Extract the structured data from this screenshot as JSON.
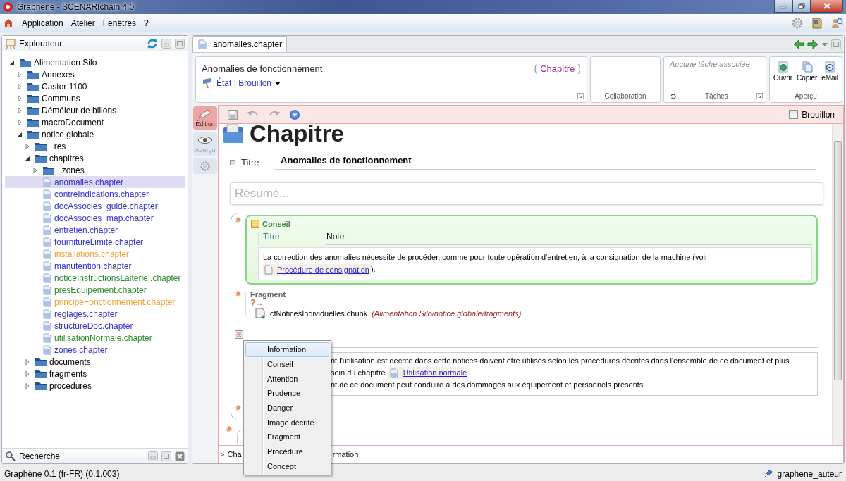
{
  "window": {
    "title": "Graphene - SCENARIchain 4.0"
  },
  "menu": [
    "Application",
    "Atelier",
    "Fenêtres",
    "?"
  ],
  "explorer": {
    "title": "Explorateur",
    "tree": [
      {
        "label": "Alimentation Silo",
        "kind": "folder",
        "expanded": true,
        "selected": false,
        "children": [
          {
            "label": "Annexes",
            "kind": "folder",
            "expanded": false,
            "selected": false
          },
          {
            "label": "Castor 1100",
            "kind": "folder",
            "expanded": false,
            "selected": false
          },
          {
            "label": "Communs",
            "kind": "folder",
            "expanded": false,
            "selected": false
          },
          {
            "label": "Déméleur de billons",
            "kind": "folder",
            "expanded": false,
            "selected": false
          },
          {
            "label": "macroDocument",
            "kind": "folder",
            "expanded": false,
            "selected": false
          },
          {
            "label": "notice globale",
            "kind": "folder",
            "expanded": true,
            "selected": false,
            "children": [
              {
                "label": "_res",
                "kind": "folder",
                "expanded": false,
                "selected": false
              },
              {
                "label": "chapitres",
                "kind": "folder",
                "expanded": true,
                "selected": false,
                "children": [
                  {
                    "label": "_zones",
                    "kind": "folder",
                    "expanded": false,
                    "selected": false
                  },
                  {
                    "label": "anomalies.chapter",
                    "kind": "file",
                    "selected": true,
                    "color": "#3232d6"
                  },
                  {
                    "label": "contreIndications.chapter",
                    "kind": "file",
                    "selected": false,
                    "color": "#3232d6"
                  },
                  {
                    "label": "docAssocies_guide.chapter",
                    "kind": "file",
                    "selected": false,
                    "color": "#3232d6"
                  },
                  {
                    "label": "docAssocies_map.chapter",
                    "kind": "file",
                    "selected": false,
                    "color": "#3232d6"
                  },
                  {
                    "label": "entretien.chapter",
                    "kind": "file",
                    "selected": false,
                    "color": "#3232d6"
                  },
                  {
                    "label": "fournitureLimite.chapter",
                    "kind": "file",
                    "selected": false,
                    "color": "#3232d6"
                  },
                  {
                    "label": "installations.chapter",
                    "kind": "file",
                    "selected": false,
                    "color": "#f2a12e"
                  },
                  {
                    "label": "manutention.chapter",
                    "kind": "file",
                    "selected": false,
                    "color": "#3232d6"
                  },
                  {
                    "label": "noticeInstructionsLaiterie .chapter",
                    "kind": "file",
                    "selected": false,
                    "color": "#2b8a2b"
                  },
                  {
                    "label": "presEquipement.chapter",
                    "kind": "file",
                    "selected": false,
                    "color": "#2b8a2b"
                  },
                  {
                    "label": "principeFonctionnement.chapter",
                    "kind": "file",
                    "selected": false,
                    "color": "#f2a12e"
                  },
                  {
                    "label": "reglages.chapter",
                    "kind": "file",
                    "selected": false,
                    "color": "#3232d6"
                  },
                  {
                    "label": "structureDoc.chapter",
                    "kind": "file",
                    "selected": false,
                    "color": "#3232d6"
                  },
                  {
                    "label": "utilisationNormale.chapter",
                    "kind": "file",
                    "selected": false,
                    "color": "#2b8a2b"
                  },
                  {
                    "label": "zones.chapter",
                    "kind": "file",
                    "selected": false,
                    "color": "#3232d6"
                  }
                ]
              },
              {
                "label": "documents",
                "kind": "folder",
                "expanded": false,
                "selected": false
              },
              {
                "label": "fragments",
                "kind": "folder",
                "expanded": false,
                "selected": false
              },
              {
                "label": "procedures",
                "kind": "folder",
                "expanded": false,
                "selected": false
              }
            ]
          }
        ]
      }
    ]
  },
  "search_panel": {
    "title": "Recherche"
  },
  "editor_tabs": [
    {
      "label": "anomalies.chapter",
      "selected": true
    }
  ],
  "header": {
    "title": "Anomalies de fonctionnement",
    "type_open": "(",
    "type": "Chapitre",
    "type_close": ")",
    "state": "État : Brouillon",
    "collaboration": "Collaboration",
    "tasks_placeholder": "Aucune tâche associée",
    "tasks": "Tâches",
    "preview_actions": [
      "Ouvrir",
      "Copier",
      "eMail"
    ],
    "preview": "Aperçu"
  },
  "side_tabs": [
    {
      "kind": "edit",
      "label": "Édition",
      "selected": true
    },
    {
      "kind": "preview",
      "label": "Aperçu",
      "selected": false
    },
    {
      "kind": "settings",
      "selected": false
    }
  ],
  "toolbar": {
    "draft": {
      "label": "Brouillon",
      "checked": false
    }
  },
  "document": {
    "heading": "Chapitre",
    "title_label": "Titre",
    "title_value": "Anomalies de fonctionnement",
    "summary_placeholder": "Résumé...",
    "conseil": {
      "label": "Conseil",
      "title_label": "Titre",
      "title_value": "Note :",
      "text": "La correction des anomalies nécessite de procéder, comme pour toute opération d'entretien, à la consignation de la machine (voir",
      "link": "Procédure de consignation",
      "after": ")."
    },
    "fragment": {
      "label": "Fragment",
      "marker": "?→",
      "file": "cfNoticesIndividuelles.chunk",
      "path": "(Alimentation Silo/notice globale/fragments)"
    },
    "partial_lines": [
      {
        "text": "nt l'utilisation est décrite dans cette notices doivent être utilisés selon les procédures décrites dans l'ensemble de ce document et plus"
      },
      {
        "text": "sein du chapitre",
        "link": "Utilisation normale",
        "after": "."
      },
      {
        "text": "nt de ce document peut conduire à des dommages aux équipement et personnels présents."
      }
    ]
  },
  "breadcrumb": {
    "marker": ">",
    "start": "Cha",
    "end": "rmation"
  },
  "context_menu": [
    {
      "label": "Information",
      "selected": true
    },
    {
      "label": "Conseil",
      "selected": false
    },
    {
      "label": "Attention",
      "selected": false
    },
    {
      "label": "Prudence",
      "selected": false
    },
    {
      "label": "Danger",
      "selected": false
    },
    {
      "label": "Image décrite",
      "selected": false
    },
    {
      "label": "Fragment",
      "selected": false
    },
    {
      "label": "Procédure",
      "selected": false
    },
    {
      "label": "Concept",
      "selected": false
    }
  ],
  "status_bar": {
    "version": "Graphène 0.1 (fr-FR) (0.1.003)",
    "user": "graphene_auteur"
  }
}
